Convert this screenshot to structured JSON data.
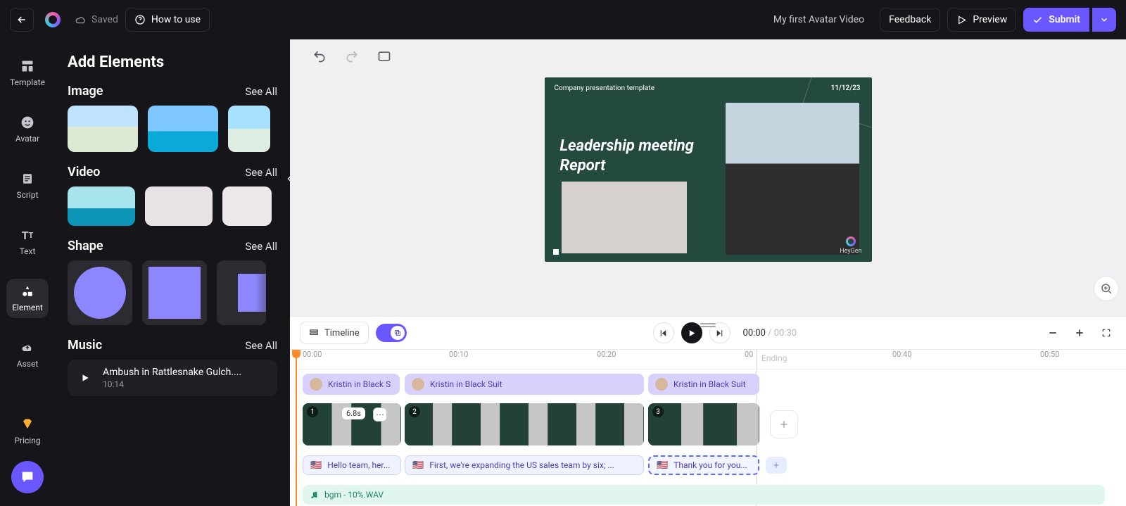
{
  "topbar": {
    "saved": "Saved",
    "howto": "How to use",
    "project": "My first Avatar Video",
    "feedback": "Feedback",
    "preview": "Preview",
    "submit": "Submit"
  },
  "nav": [
    "Template",
    "Avatar",
    "Script",
    "Text",
    "Element",
    "Asset",
    "Pricing"
  ],
  "panel": {
    "title": "Add Elements",
    "seeall": "See All",
    "sections": {
      "image": "Image",
      "video": "Video",
      "shape": "Shape",
      "music": "Music"
    },
    "music": {
      "title": "Ambush in Rattlesnake Gulch....",
      "duration": "10:14"
    }
  },
  "canvas": {
    "template": "Company presentation template",
    "date": "11/12/23",
    "title": "Leadership meeting Report",
    "brand": "HeyGen"
  },
  "play": {
    "timeline": "Timeline",
    "current": "00:00",
    "total": "00:30"
  },
  "ruler": [
    "00:00",
    "00:10",
    "00:20",
    "00",
    "00:40",
    "00:50"
  ],
  "ruler_ending": "Ending",
  "timeline": {
    "avatar": [
      "Kristin in Black S",
      "Kristin in Black Suit",
      "Kristin in Black Suit"
    ],
    "scenes": [
      {
        "idx": "1",
        "dur": "6.8s"
      },
      {
        "idx": "2",
        "dur": ""
      },
      {
        "idx": "3",
        "dur": ""
      }
    ],
    "scripts": [
      "Hello team, her...",
      "First, we're expanding the US sales team by six; ...",
      "Thank you for you..."
    ],
    "music": "bgm - 10%.WAV"
  }
}
